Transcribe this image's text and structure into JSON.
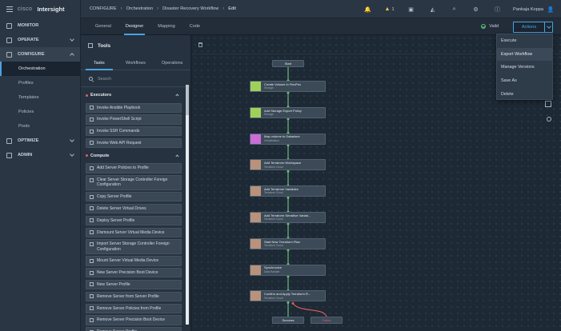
{
  "brand": {
    "vendor": "cisco",
    "product": "Intersight"
  },
  "nav": {
    "sections": [
      {
        "label": "MONITOR",
        "icon": "monitor-icon",
        "chevron": false
      },
      {
        "label": "OPERATE",
        "icon": "operate-icon",
        "chevron": "down"
      },
      {
        "label": "CONFIGURE",
        "icon": "configure-icon",
        "chevron": "up",
        "active": true
      },
      {
        "label": "OPTIMIZE",
        "icon": "optimize-icon",
        "chevron": "down"
      },
      {
        "label": "ADMIN",
        "icon": "admin-icon",
        "chevron": "down"
      }
    ],
    "configure_items": [
      "Orchestration",
      "Profiles",
      "Templates",
      "Policies",
      "Pools"
    ],
    "current_item": "Orchestration"
  },
  "breadcrumb": [
    "CONFIGURE",
    "Orchestration",
    "Disaster Recovery Workflow",
    "Edit"
  ],
  "header": {
    "warning_count": "1",
    "user_name": "Pankaja Koppa",
    "icons": [
      "bell-icon",
      "warning-icon",
      "clipboard-icon",
      "megaphone-icon",
      "search-icon",
      "settings-icon",
      "help-icon",
      "user-icon"
    ]
  },
  "tabs": [
    "General",
    "Designer",
    "Mapping",
    "Code"
  ],
  "active_tab": "Designer",
  "status": {
    "valid_label": "Valid",
    "valid_color": "#5bbf74"
  },
  "actions": {
    "label": "Actions",
    "menu": [
      "Execute",
      "Export Workflow",
      "Manage Versions",
      "Save As",
      "Delete"
    ],
    "hovered": "Export Workflow"
  },
  "tools": {
    "title": "Tools",
    "subtabs": [
      "Tasks",
      "Workflows",
      "Operations"
    ],
    "active_subtab": "Tasks",
    "search_placeholder": "Search",
    "categories": [
      {
        "name": "Executors",
        "items": [
          "Invoke Ansible Playbook",
          "Invoke PowerShell Script",
          "Invoke SSH Commands",
          "Invoke Web API Request"
        ]
      },
      {
        "name": "Compute",
        "items": [
          "Add Server Policies to Profile",
          "Clear Server Storage Controller Foreign Configuration",
          "Copy Server Profile",
          "Delete Server Virtual Drives",
          "Deploy Server Profile",
          "Dismount Server Virtual Media Device",
          "Import Server Storage Controller Foreign Configuration",
          "Mount Server Virtual Media Device",
          "New Server Precision Boot Device",
          "New Server Profile",
          "Remove Server from Server Profile",
          "Remove Server Policies from Profile",
          "Remove Server Precision Boot Device",
          "Remove Server Profile"
        ]
      }
    ]
  },
  "workflow": {
    "start_label": "Start",
    "success_label": "Success",
    "failed_label": "Failed",
    "colors": {
      "storage": "#9fd15a",
      "virtualization": "#c86ed6",
      "terraform": "#b8927a",
      "flow": "#6fbf7d",
      "failure": "#e05b5b"
    },
    "nodes": [
      {
        "name": "Create Volume in FlexPod",
        "type": "Storage",
        "kind": "storage"
      },
      {
        "name": "Add Storage Export Policy",
        "type": "Storage",
        "kind": "storage"
      },
      {
        "name": "Map volume to Datastore",
        "type": "Virtualization",
        "kind": "virtualization"
      },
      {
        "name": "Add Terraform Workspace",
        "type": "Terraform Cloud",
        "kind": "terraform"
      },
      {
        "name": "Add Terraform Variables",
        "type": "Terraform Cloud",
        "kind": "terraform"
      },
      {
        "name": "Add Terraform Sensitive Variab...",
        "type": "Terraform Cloud",
        "kind": "terraform"
      },
      {
        "name": "Start New Terraform Plan",
        "type": "Terraform Cloud",
        "kind": "terraform"
      },
      {
        "name": "Synchronize",
        "type": "Data Handler",
        "kind": "terraform"
      },
      {
        "name": "Confirm and Apply Terraform R...",
        "type": "Terraform Cloud",
        "kind": "terraform"
      }
    ]
  }
}
